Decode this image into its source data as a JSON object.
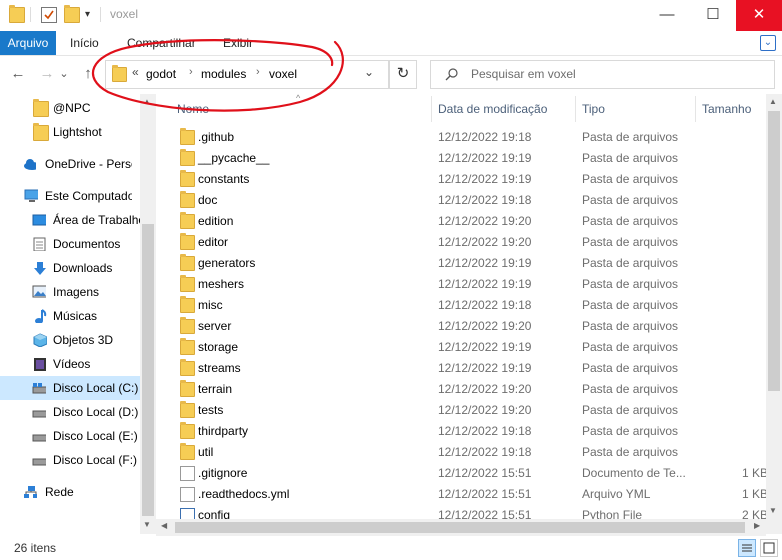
{
  "window": {
    "title": "voxel",
    "controls": {
      "minimize": "—",
      "maximize": "☐",
      "close": "✕"
    }
  },
  "ribbon": {
    "tabs": [
      "Arquivo",
      "Início",
      "Compartilhar",
      "Exibir"
    ],
    "expand": "⌄"
  },
  "nav": {
    "back": "←",
    "forward": "→",
    "recent": "⌄",
    "up": "↑",
    "overflow": "«",
    "breadcrumb": [
      "godot",
      "modules",
      "voxel"
    ],
    "separator": "›",
    "dropdown": "⌄",
    "refresh": "↻",
    "search_placeholder": "Pesquisar em voxel"
  },
  "sidebar": {
    "items": [
      {
        "label": "@NPC",
        "icon": "folder-icon"
      },
      {
        "label": "Lightshot",
        "icon": "folder-icon"
      },
      {
        "label": "OneDrive - Personal",
        "icon": "onedrive-icon"
      },
      {
        "label": "Este Computador",
        "icon": "computer-icon"
      },
      {
        "label": "Área de Trabalho",
        "icon": "desktop-icon"
      },
      {
        "label": "Documentos",
        "icon": "documents-icon"
      },
      {
        "label": "Downloads",
        "icon": "downloads-icon"
      },
      {
        "label": "Imagens",
        "icon": "pictures-icon"
      },
      {
        "label": "Músicas",
        "icon": "music-icon"
      },
      {
        "label": "Objetos 3D",
        "icon": "objects3d-icon"
      },
      {
        "label": "Vídeos",
        "icon": "videos-icon"
      },
      {
        "label": "Disco Local (C:)",
        "icon": "drive-icon"
      },
      {
        "label": "Disco Local (D:)",
        "icon": "drive-icon"
      },
      {
        "label": "Disco Local (E:)",
        "icon": "drive-icon"
      },
      {
        "label": "Disco Local (F:)",
        "icon": "drive-icon"
      },
      {
        "label": "Rede",
        "icon": "network-icon"
      }
    ]
  },
  "columns": {
    "name": "Nome",
    "date": "Data de modificação",
    "type": "Tipo",
    "size": "Tamanho"
  },
  "files": [
    {
      "name": ".github",
      "date": "12/12/2022 19:18",
      "type": "Pasta de arquivos",
      "size": ""
    },
    {
      "name": "__pycache__",
      "date": "12/12/2022 19:19",
      "type": "Pasta de arquivos",
      "size": ""
    },
    {
      "name": "constants",
      "date": "12/12/2022 19:19",
      "type": "Pasta de arquivos",
      "size": ""
    },
    {
      "name": "doc",
      "date": "12/12/2022 19:18",
      "type": "Pasta de arquivos",
      "size": ""
    },
    {
      "name": "edition",
      "date": "12/12/2022 19:20",
      "type": "Pasta de arquivos",
      "size": ""
    },
    {
      "name": "editor",
      "date": "12/12/2022 19:20",
      "type": "Pasta de arquivos",
      "size": ""
    },
    {
      "name": "generators",
      "date": "12/12/2022 19:19",
      "type": "Pasta de arquivos",
      "size": ""
    },
    {
      "name": "meshers",
      "date": "12/12/2022 19:19",
      "type": "Pasta de arquivos",
      "size": ""
    },
    {
      "name": "misc",
      "date": "12/12/2022 19:18",
      "type": "Pasta de arquivos",
      "size": ""
    },
    {
      "name": "server",
      "date": "12/12/2022 19:20",
      "type": "Pasta de arquivos",
      "size": ""
    },
    {
      "name": "storage",
      "date": "12/12/2022 19:19",
      "type": "Pasta de arquivos",
      "size": ""
    },
    {
      "name": "streams",
      "date": "12/12/2022 19:19",
      "type": "Pasta de arquivos",
      "size": ""
    },
    {
      "name": "terrain",
      "date": "12/12/2022 19:20",
      "type": "Pasta de arquivos",
      "size": ""
    },
    {
      "name": "tests",
      "date": "12/12/2022 19:20",
      "type": "Pasta de arquivos",
      "size": ""
    },
    {
      "name": "thirdparty",
      "date": "12/12/2022 19:18",
      "type": "Pasta de arquivos",
      "size": ""
    },
    {
      "name": "util",
      "date": "12/12/2022 19:18",
      "type": "Pasta de arquivos",
      "size": ""
    },
    {
      "name": ".gitignore",
      "date": "12/12/2022 15:51",
      "type": "Documento de Te...",
      "size": "1 KB"
    },
    {
      "name": ".readthedocs.yml",
      "date": "12/12/2022 15:51",
      "type": "Arquivo YML",
      "size": "1 KB"
    },
    {
      "name": "config",
      "date": "12/12/2022 15:51",
      "type": "Python File",
      "size": "2 KB"
    }
  ],
  "status": {
    "count": "26 itens"
  },
  "colors": {
    "accent": "#1979ca",
    "selection": "#cce8ff",
    "close": "#e81123",
    "annotation": "#e0101a",
    "folder": "#f6cd55"
  }
}
